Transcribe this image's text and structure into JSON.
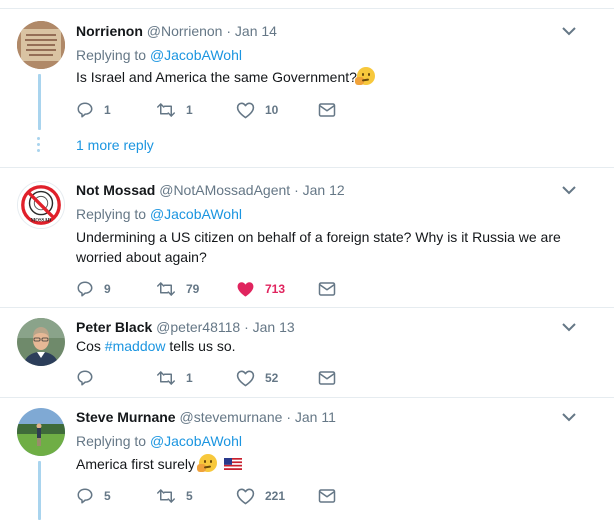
{
  "tweets": [
    {
      "name": "Norrienon",
      "handle": "@Norrienon",
      "dot": "·",
      "date": "Jan 14",
      "replying_label": "Replying to",
      "replying_to": "@JacobAWohl",
      "text": "Is Israel and America the same Government?",
      "emoji": "thinking-face",
      "replies": "1",
      "retweets": "1",
      "likes": "10",
      "more_replies": "1 more reply"
    },
    {
      "name": "Not Mossad",
      "handle": "@NotAMossadAgent",
      "dot": "·",
      "date": "Jan 12",
      "replying_label": "Replying to",
      "replying_to": "@JacobAWohl",
      "text": "Undermining a US citizen on behalf of a foreign state? Why is it Russia we are worried about again?",
      "avatar_text": "MOSSAD",
      "replies": "9",
      "retweets": "79",
      "likes": "713",
      "liked": true
    },
    {
      "name": "Peter Black",
      "handle": "@peter48118",
      "dot": "·",
      "date": "Jan 13",
      "text_before": "Cos ",
      "hashtag": "#maddow",
      "text_after": " tells us so.",
      "replies": "",
      "retweets": "1",
      "likes": "52"
    },
    {
      "name": "Steve Murnane",
      "handle": "@stevemurnane",
      "dot": "·",
      "date": "Jan 11",
      "replying_label": "Replying to",
      "replying_to": "@JacobAWohl",
      "text": "America first surely",
      "emoji": "thinking-face",
      "emoji2": "us-flag",
      "replies": "5",
      "retweets": "5",
      "likes": "221"
    }
  ],
  "colors": {
    "accent": "#1b95e0",
    "like": "#e0245e",
    "secondary_text": "#657786",
    "thread_line": "#a9d4ee"
  }
}
